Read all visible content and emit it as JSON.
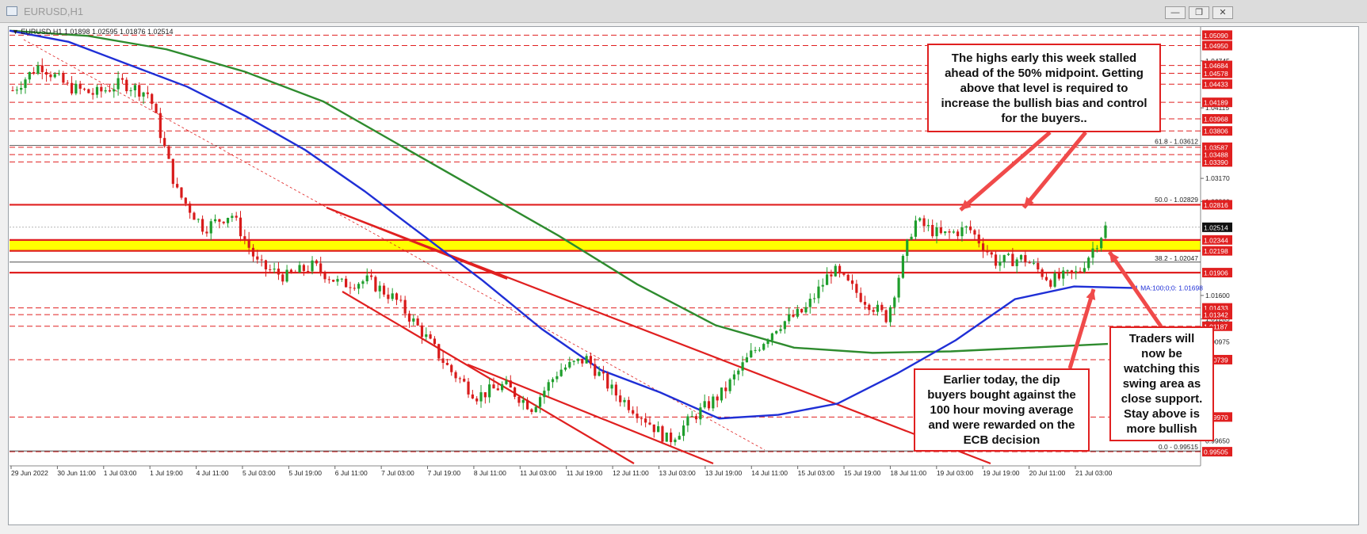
{
  "window": {
    "title": "EURUSD,H1",
    "buttons": [
      "minimize",
      "restore",
      "close"
    ]
  },
  "header": {
    "symbol_line": "▼ EURUSD,H1  1.01898 1.02595 1.01876 1.02514"
  },
  "colors": {
    "background": "#ffffff",
    "candle_up": "#1e9e2c",
    "candle_down": "#d81b1b",
    "ma_100": "#1f2fd6",
    "ma_200": "#2e8b2e",
    "levels": "#e02020",
    "yellow_zone": "#ffff00",
    "label_bg": "#e02020"
  },
  "annotations": {
    "top_right": "The highs early this week stalled ahead of the 50% midpoint. Getting above that level is required to increase the bullish bias and control for the buyers..",
    "bottom_middle": "Earlier today, the dip buyers bought against the 100 hour moving average and were rewarded on the ECB decision",
    "right": "Traders will now be watching this swing area as close support. Stay above is more bullish"
  },
  "chart_data": {
    "type": "candlestick",
    "symbol": "EURUSD",
    "timeframe": "H1",
    "ohlc_current": {
      "open": 1.01898,
      "high": 1.02595,
      "low": 1.01876,
      "close": 1.02514
    },
    "y_range": [
      0.994,
      1.052
    ],
    "x_tick_labels": [
      "29 Jun 2022",
      "30 Jun 11:00",
      "1 Jul 03:00",
      "1 Jul 19:00",
      "4 Jul 11:00",
      "5 Jul 03:00",
      "5 Jul 19:00",
      "6 Jul 11:00",
      "7 Jul 03:00",
      "7 Jul 19:00",
      "8 Jul 11:00",
      "11 Jul 03:00",
      "11 Jul 19:00",
      "12 Jul 11:00",
      "13 Jul 03:00",
      "13 Jul 19:00",
      "14 Jul 11:00",
      "15 Jul 03:00",
      "15 Jul 19:00",
      "18 Jul 11:00",
      "19 Jul 03:00",
      "19 Jul 19:00",
      "20 Jul 11:00",
      "21 Jul 03:00"
    ],
    "y_tick_labels": [
      "1.04745",
      "1.04115",
      "1.03170",
      "1.02860",
      "1.01600",
      "1.01285",
      "1.00975",
      "0.99650"
    ],
    "highlighted_levels": [
      {
        "label": "1.05090",
        "value": 1.0509,
        "style": "dashed"
      },
      {
        "label": "1.04950",
        "value": 1.0495,
        "style": "dashed"
      },
      {
        "label": "1.04684",
        "value": 1.04684,
        "style": "dashed"
      },
      {
        "label": "1.04578",
        "value": 1.04578,
        "style": "dashed"
      },
      {
        "label": "1.04433",
        "value": 1.04433,
        "style": "dashed"
      },
      {
        "label": "1.04189",
        "value": 1.04189,
        "style": "dashed"
      },
      {
        "label": "1.03968",
        "value": 1.03968,
        "style": "dashed"
      },
      {
        "label": "1.03806",
        "value": 1.03806,
        "style": "dashed"
      },
      {
        "label": "1.03587",
        "value": 1.03587,
        "style": "dashed"
      },
      {
        "label": "1.03488",
        "value": 1.03488,
        "style": "dashed"
      },
      {
        "label": "1.03390",
        "value": 1.0339,
        "style": "dashed"
      },
      {
        "label": "1.02816",
        "value": 1.02816,
        "style": "solid"
      },
      {
        "label": "1.02514",
        "value": 1.02514,
        "style": "current"
      },
      {
        "label": "1.02344",
        "value": 1.02344,
        "style": "solid"
      },
      {
        "label": "1.02198",
        "value": 1.02198,
        "style": "solid"
      },
      {
        "label": "1.01906",
        "value": 1.01906,
        "style": "solid"
      },
      {
        "label": "1.01433",
        "value": 1.01433,
        "style": "dashed"
      },
      {
        "label": "1.01342",
        "value": 1.01342,
        "style": "dashed"
      },
      {
        "label": "1.01187",
        "value": 1.01187,
        "style": "dashed"
      },
      {
        "label": "1.00739",
        "value": 1.00739,
        "style": "dashed"
      },
      {
        "label": "0.99970",
        "value": 0.9997,
        "style": "dashed"
      },
      {
        "label": "0.99505",
        "value": 0.99505,
        "style": "dashed"
      }
    ],
    "yellow_zone": [
      1.02198,
      1.02344
    ],
    "fib_levels": [
      {
        "label": "61.8 - 1.03612",
        "value": 1.03612
      },
      {
        "label": "50.0 - 1.02829",
        "value": 1.02829
      },
      {
        "label": "38.2 - 1.02047",
        "value": 1.02047
      },
      {
        "label": "0.0 - 0.99515",
        "value": 0.99515
      }
    ],
    "ma_label": "1 MA:100;0;0: 1.01698",
    "ma_100": [
      1.0515,
      1.05,
      1.047,
      1.044,
      1.04,
      1.0355,
      1.03,
      1.024,
      1.018,
      1.0115,
      1.006,
      1.003,
      0.9995,
      1.0,
      1.0015,
      1.0055,
      1.01,
      1.0155,
      1.0172,
      1.017
    ],
    "ma_200": [
      1.0515,
      1.0508,
      1.049,
      1.046,
      1.042,
      1.036,
      1.03,
      1.024,
      1.0175,
      1.012,
      1.009,
      1.0083,
      1.0085,
      1.009,
      1.0095
    ],
    "price_path": [
      1.0435,
      1.047,
      1.044,
      1.043,
      1.0445,
      1.043,
      1.03,
      1.025,
      1.027,
      1.02,
      1.0185,
      1.02,
      1.0175,
      1.018,
      1.0155,
      1.011,
      1.006,
      1.0025,
      1.004,
      1.001,
      1.006,
      1.0075,
      1.003,
      1.0,
      0.9965,
      1.0,
      1.003,
      1.008,
      1.012,
      1.014,
      1.0195,
      1.016,
      1.013,
      1.026,
      1.024,
      1.025,
      1.0205,
      1.021,
      1.018,
      1.019,
      1.0251
    ]
  }
}
